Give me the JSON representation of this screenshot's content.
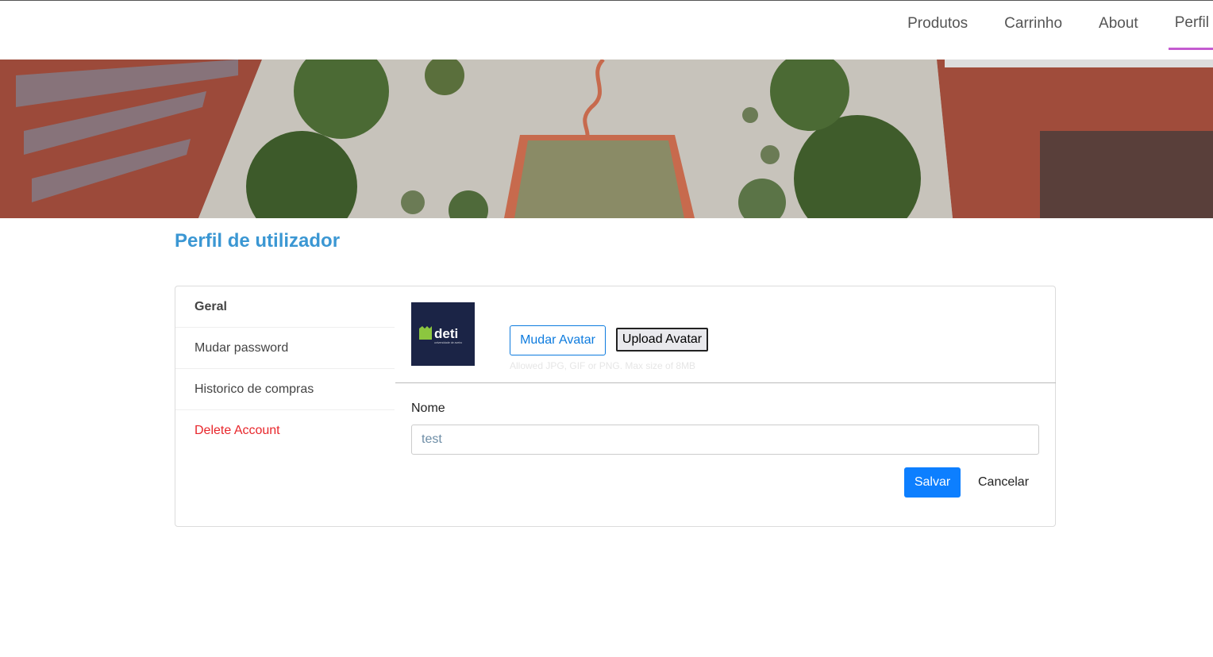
{
  "nav": {
    "items": [
      {
        "label": "Produtos"
      },
      {
        "label": "Carrinho"
      },
      {
        "label": "About"
      },
      {
        "label": "Perfil"
      }
    ]
  },
  "page": {
    "title": "Perfil de utilizador"
  },
  "sidebar": {
    "items": [
      {
        "label": "Geral"
      },
      {
        "label": "Mudar password"
      },
      {
        "label": "Historico de compras"
      },
      {
        "label": "Delete Account"
      }
    ]
  },
  "avatar": {
    "logo_text": "deti",
    "logo_subtext": "universidade de aveiro",
    "change_label": "Mudar Avatar",
    "upload_label": "Upload Avatar",
    "hint": "Allowed JPG, GIF or PNG. Max size of 8MB"
  },
  "form": {
    "name_label": "Nome",
    "name_value": "test",
    "save_label": "Salvar",
    "cancel_label": "Cancelar"
  },
  "colors": {
    "title": "#3b97d3",
    "active_tab_underline": "#c45bd0",
    "primary": "#0d7fff",
    "danger": "#e8262b"
  }
}
